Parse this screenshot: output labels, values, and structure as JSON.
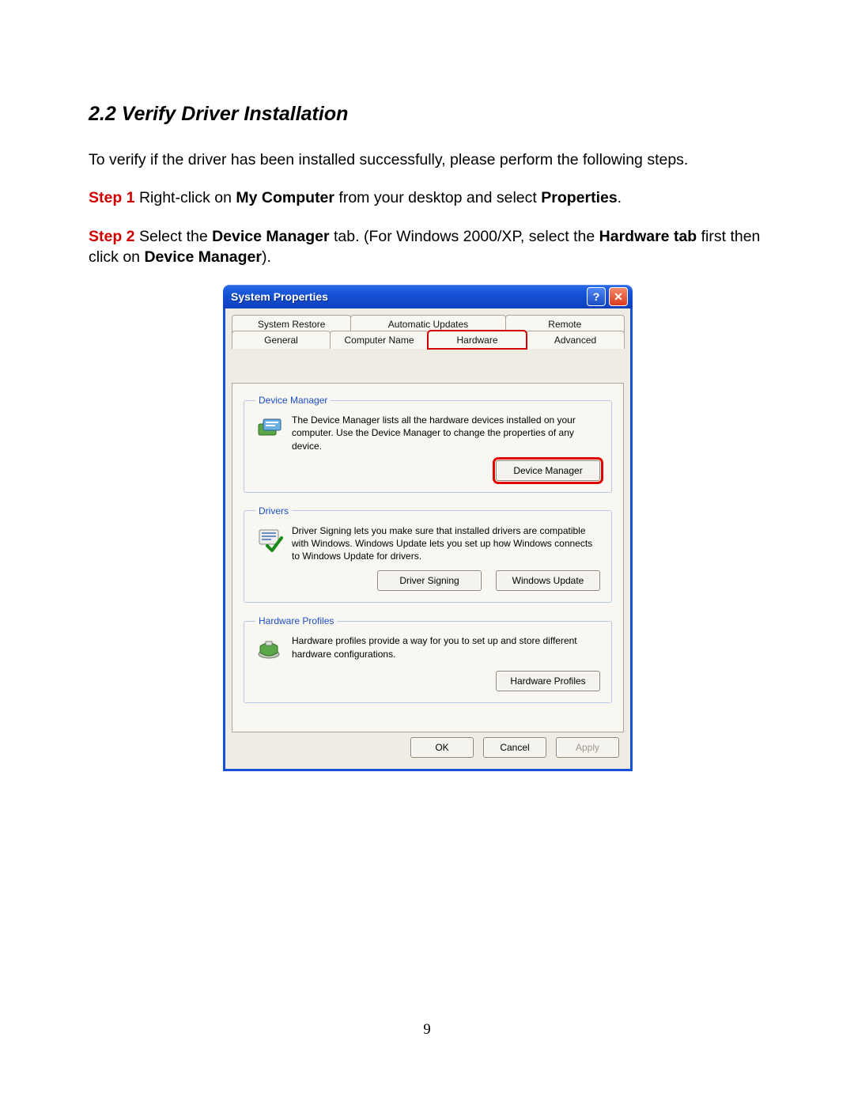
{
  "doc": {
    "section_title": "2.2 Verify Driver Installation",
    "intro": "To verify if the driver has been installed successfully, please perform the following steps.",
    "step1": {
      "label": "Step 1",
      "t1": " Right-click on ",
      "b1": "My Computer",
      "t2": " from your desktop and select ",
      "b2": "Properties",
      "t3": "."
    },
    "step2": {
      "label": "Step 2",
      "t1": " Select the ",
      "b1": "Device Manager",
      "t2": " tab. (For Windows 2000/XP, select the ",
      "b2": "Hardware tab",
      "t3": " first then click on ",
      "b3": "Device Manager",
      "t4": ")."
    },
    "page_number": "9"
  },
  "dialog": {
    "title": "System Properties",
    "tabs_back": [
      "System Restore",
      "Automatic Updates",
      "Remote"
    ],
    "tabs_front": [
      "General",
      "Computer Name",
      "Hardware",
      "Advanced"
    ],
    "groups": {
      "device_manager": {
        "legend": "Device Manager",
        "text": "The Device Manager lists all the hardware devices installed on your computer. Use the Device Manager to change the properties of any device.",
        "button": "Device Manager"
      },
      "drivers": {
        "legend": "Drivers",
        "text": "Driver Signing lets you make sure that installed drivers are compatible with Windows. Windows Update lets you set up how Windows connects to Windows Update for drivers.",
        "button1": "Driver Signing",
        "button2": "Windows Update"
      },
      "hardware_profiles": {
        "legend": "Hardware Profiles",
        "text": "Hardware profiles provide a way for you to set up and store different hardware configurations.",
        "button": "Hardware Profiles"
      }
    },
    "buttons": {
      "ok": "OK",
      "cancel": "Cancel",
      "apply": "Apply"
    }
  }
}
